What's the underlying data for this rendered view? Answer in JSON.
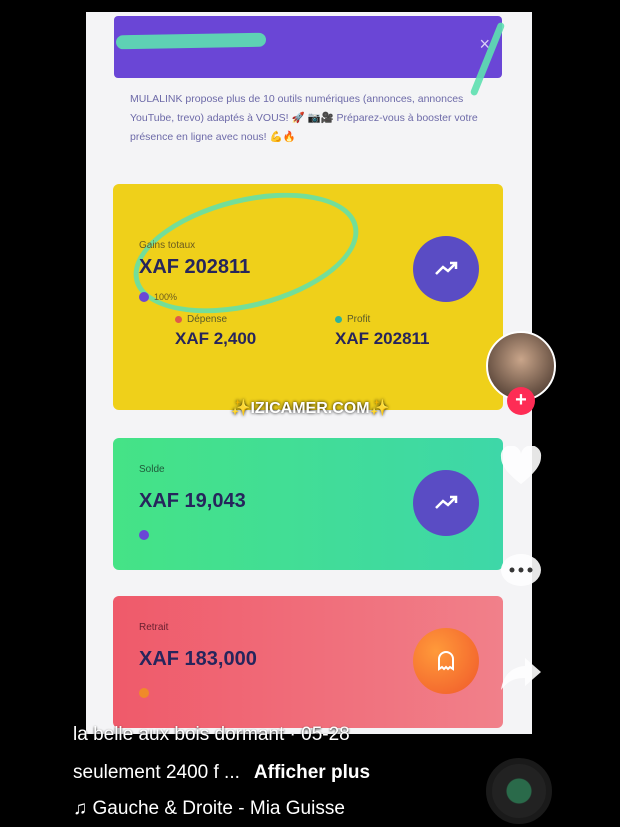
{
  "app": {
    "header_title": "",
    "promo_text": "MULALINK propose plus de 10 outils numériques (annonces, annonces YouTube, trevo) adaptés à VOUS! 🚀 📷🎥 Préparez-vous à booster votre présence en ligne avec nous! 💪🔥"
  },
  "cards": {
    "total": {
      "label": "Gains totaux",
      "value": "XAF 202811",
      "sub": "100%",
      "expense_label": "Dépense",
      "expense_value": "XAF 2,400",
      "profit_label": "Profit",
      "profit_value": "XAF 202811"
    },
    "balance": {
      "label": "Solde",
      "value": "XAF 19,043",
      "sub": ""
    },
    "withdrawals": {
      "label": "Retrait",
      "value": "XAF 183,000",
      "sub": ""
    }
  },
  "watermark": "✨IZICAMER.COM✨",
  "video": {
    "username": "la belle aux bois dormant · 05-28",
    "description": "seulement 2400 f ...",
    "show_more": "Afficher plus",
    "music": "♫ Gauche & Droite - Mia Guisse"
  },
  "icons": [
    "close-icon",
    "trend-up-icon",
    "ghost-icon",
    "heart-icon",
    "comment-icon",
    "share-icon",
    "music-note-icon"
  ],
  "colors": {
    "accent": "#6a46d6",
    "yellow_card": "#efd01a",
    "green_card": "#45e386",
    "red_card": "#ef5a6a",
    "follow": "#fe2c55"
  }
}
